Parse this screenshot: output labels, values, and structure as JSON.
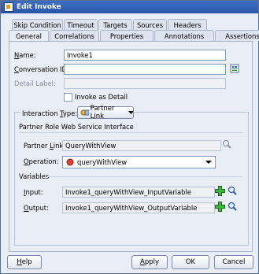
{
  "window": {
    "title": "Edit Invoke"
  },
  "tabs_row1": [
    "Skip Condition",
    "Timeout",
    "Targets",
    "Sources",
    "Headers"
  ],
  "tabs_row2": [
    "General",
    "Correlations",
    "Properties",
    "Annotations",
    "Assertions"
  ],
  "form": {
    "name_label": "Name:",
    "name_value": "Invoke1",
    "conversation_label": "Conversation ID:",
    "conversation_value": "",
    "detail_label": "Detail Label:",
    "detail_value": "",
    "invoke_as_detail_label": "Invoke as Detail",
    "interaction_type_label": "Interaction Type:",
    "interaction_type_value": "Partner Link",
    "partner_section_title": "Partner Role Web Service Interface",
    "partner_link_label": "Partner Link:",
    "partner_link_value": "QueryWithView",
    "operation_label": "Operation:",
    "operation_value": "queryWithView",
    "variables_title": "Variables",
    "input_label": "Input:",
    "input_value": "Invoke1_queryWithView_InputVariable",
    "output_label": "Output:",
    "output_value": "Invoke1_queryWithView_OutputVariable"
  },
  "buttons": {
    "help": "Help",
    "apply": "Apply",
    "ok": "OK",
    "cancel": "Cancel"
  },
  "colors": {
    "titlebar": "#2f5fb4",
    "plus": "#2e9a2e"
  }
}
